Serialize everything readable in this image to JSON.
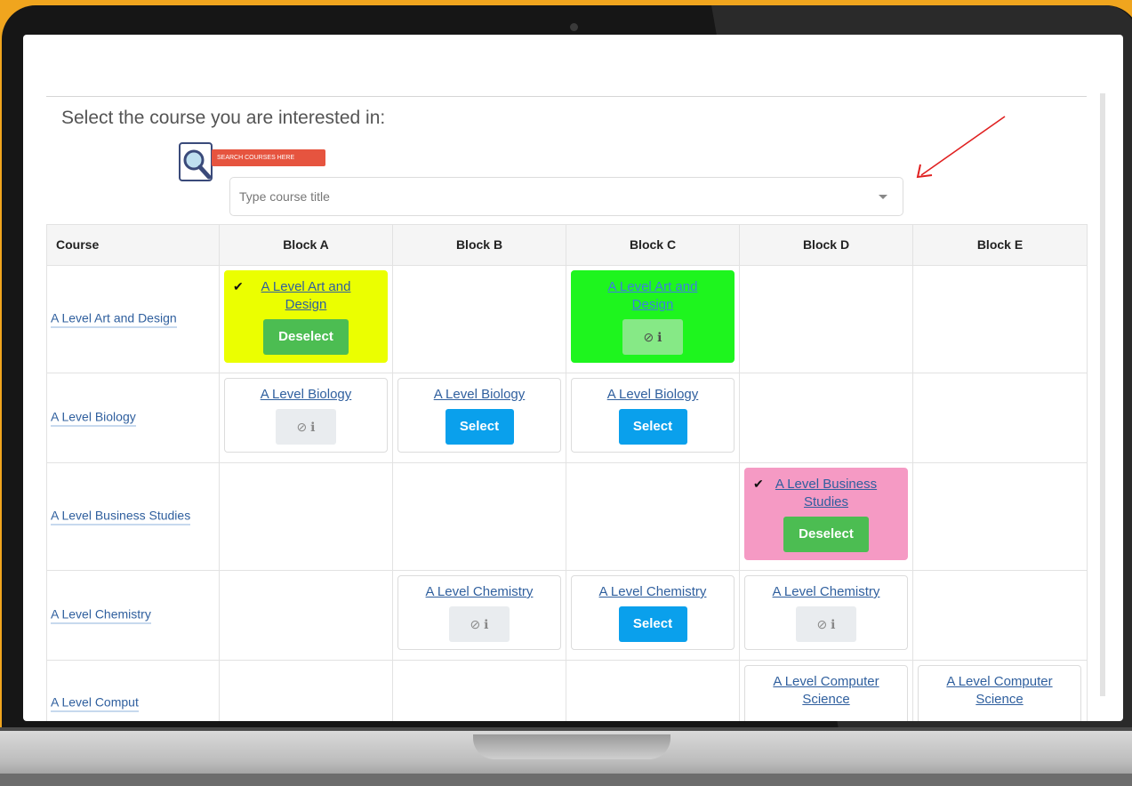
{
  "page": {
    "prompt": "Select the course you are interested in:",
    "search_banner": "SEARCH COURSES HERE",
    "search_placeholder": "Type course title"
  },
  "table": {
    "headers": [
      "Course",
      "Block A",
      "Block B",
      "Block C",
      "Block D",
      "Block E"
    ],
    "rows": [
      {
        "course": "A Level Art and Design",
        "cells": [
          {
            "block": "A",
            "title": "A Level Art and Design",
            "state": "selected",
            "button": "Deselect",
            "color": "#ebff00",
            "check": "✔"
          },
          null,
          {
            "block": "C",
            "title": "A Level Art and Design",
            "state": "unavailable",
            "color": "#1ef51e",
            "icons": "⊘ ℹ"
          },
          null,
          null
        ]
      },
      {
        "course": "A Level Biology",
        "cells": [
          {
            "block": "A",
            "title": "A Level Biology",
            "state": "unavailable",
            "icons": "⊘ ℹ"
          },
          {
            "block": "B",
            "title": "A Level Biology",
            "state": "available",
            "button": "Select"
          },
          {
            "block": "C",
            "title": "A Level Biology",
            "state": "available",
            "button": "Select"
          },
          null,
          null
        ]
      },
      {
        "course": "A Level Business Studies",
        "cells": [
          null,
          null,
          null,
          {
            "block": "D",
            "title": "A Level Business Studies",
            "state": "selected",
            "button": "Deselect",
            "color": "#f59ac4",
            "check": "✔"
          },
          null
        ]
      },
      {
        "course": "A Level Chemistry",
        "cells": [
          null,
          {
            "block": "B",
            "title": "A Level Chemistry",
            "state": "unavailable",
            "icons": "⊘ ℹ"
          },
          {
            "block": "C",
            "title": "A Level Chemistry",
            "state": "available",
            "button": "Select"
          },
          {
            "block": "D",
            "title": "A Level Chemistry",
            "state": "unavailable",
            "icons": "⊘ ℹ"
          },
          null
        ]
      },
      {
        "course": "A Level Comput",
        "cells": [
          null,
          null,
          null,
          {
            "block": "D",
            "title": "A Level Computer Science",
            "state": "partial"
          },
          {
            "block": "E",
            "title": "A Level Computer Science",
            "state": "partial"
          }
        ]
      }
    ]
  },
  "colors": {
    "background": "#f0a51e",
    "select_button": "#0aa0ec",
    "deselect_button": "#4cbd52",
    "link": "#2f5f9e",
    "annotation_arrow": "#e02020"
  }
}
